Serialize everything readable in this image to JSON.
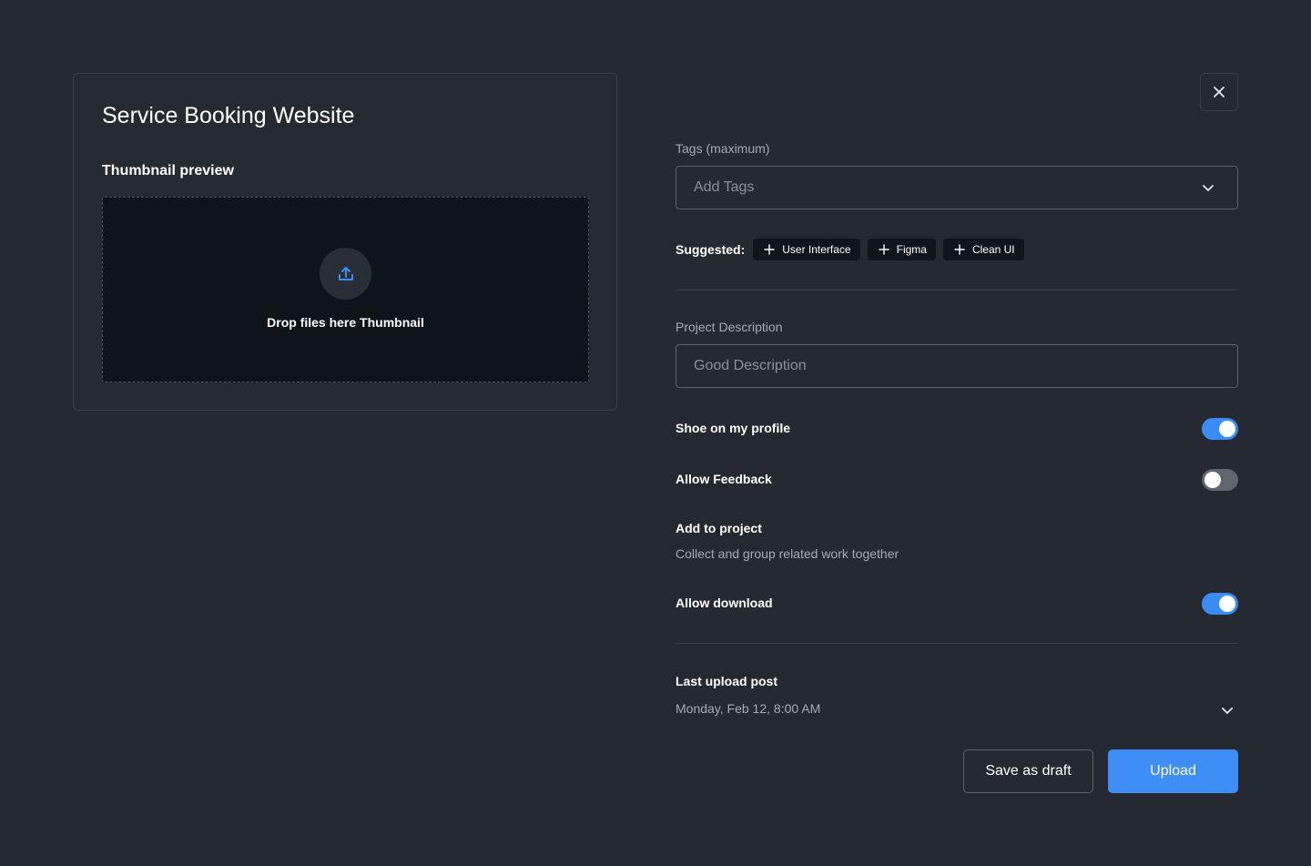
{
  "project": {
    "title": "Service Booking Website",
    "thumbnail_label": "Thumbnail preview",
    "dropzone_text": "Drop files here Thumbnail",
    "dropzone_icon": "upload-icon"
  },
  "close_icon": "close-icon",
  "tags": {
    "label": "Tags (maximum)",
    "placeholder": "Add Tags",
    "suggested_label": "Suggested:",
    "suggested": [
      "User Interface",
      "Figma",
      "Clean UI"
    ]
  },
  "description": {
    "label": "Project Description",
    "placeholder": "Good Description"
  },
  "settings": {
    "show_on_profile": {
      "label": "Shoe on my profile",
      "enabled": true
    },
    "allow_feedback": {
      "label": "Allow Feedback",
      "enabled": false
    },
    "add_to_project": {
      "label": "Add to project",
      "description": "Collect and group related work together"
    },
    "allow_download": {
      "label": "Allow download",
      "enabled": true
    }
  },
  "last_upload": {
    "label": "Last upload post",
    "value": "Monday, Feb 12, 8:00 AM"
  },
  "actions": {
    "draft_label": "Save as draft",
    "upload_label": "Upload"
  },
  "colors": {
    "background": "#252a32",
    "accent": "#3e8ef5",
    "dropzone": "#0f131a"
  }
}
